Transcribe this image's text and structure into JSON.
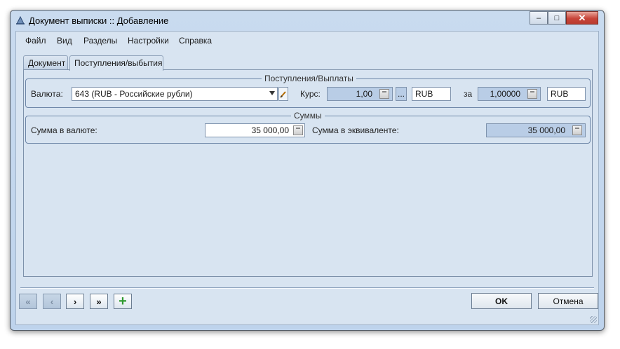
{
  "window": {
    "title": "Документ выписки :: Добавление",
    "minimize": "–",
    "maximize": "□",
    "close": "✕"
  },
  "menu": {
    "items": [
      "Файл",
      "Вид",
      "Разделы",
      "Настройки",
      "Справка"
    ]
  },
  "tabs": [
    {
      "label": "Документ"
    },
    {
      "label": "Поступления/выбытия"
    }
  ],
  "payments_group": {
    "title": "Поступления/Выплаты",
    "currency_label": "Валюта:",
    "currency_value": "643 (RUB - Российские рубли)",
    "rate_label": "Курс:",
    "rate_value": "1,00",
    "ellipsis": "...",
    "rate_currency": "RUB",
    "per_label": "за",
    "per_value": "1,00000",
    "per_currency": "RUB"
  },
  "sums_group": {
    "title": "Суммы",
    "amount_label": "Сумма в валюте:",
    "amount_value": "35 000,00",
    "equiv_label": "Сумма в эквиваленте:",
    "equiv_value": "35 000,00"
  },
  "nav": {
    "first": "«",
    "prev": "‹",
    "next": "›",
    "last": "»",
    "add": "+"
  },
  "buttons": {
    "ok": "OK",
    "cancel": "Отмена"
  },
  "colors": {
    "accent_add": "#2f9a2f",
    "title_bar": "#c9dbef",
    "readonly_field": "#b9cde6"
  }
}
